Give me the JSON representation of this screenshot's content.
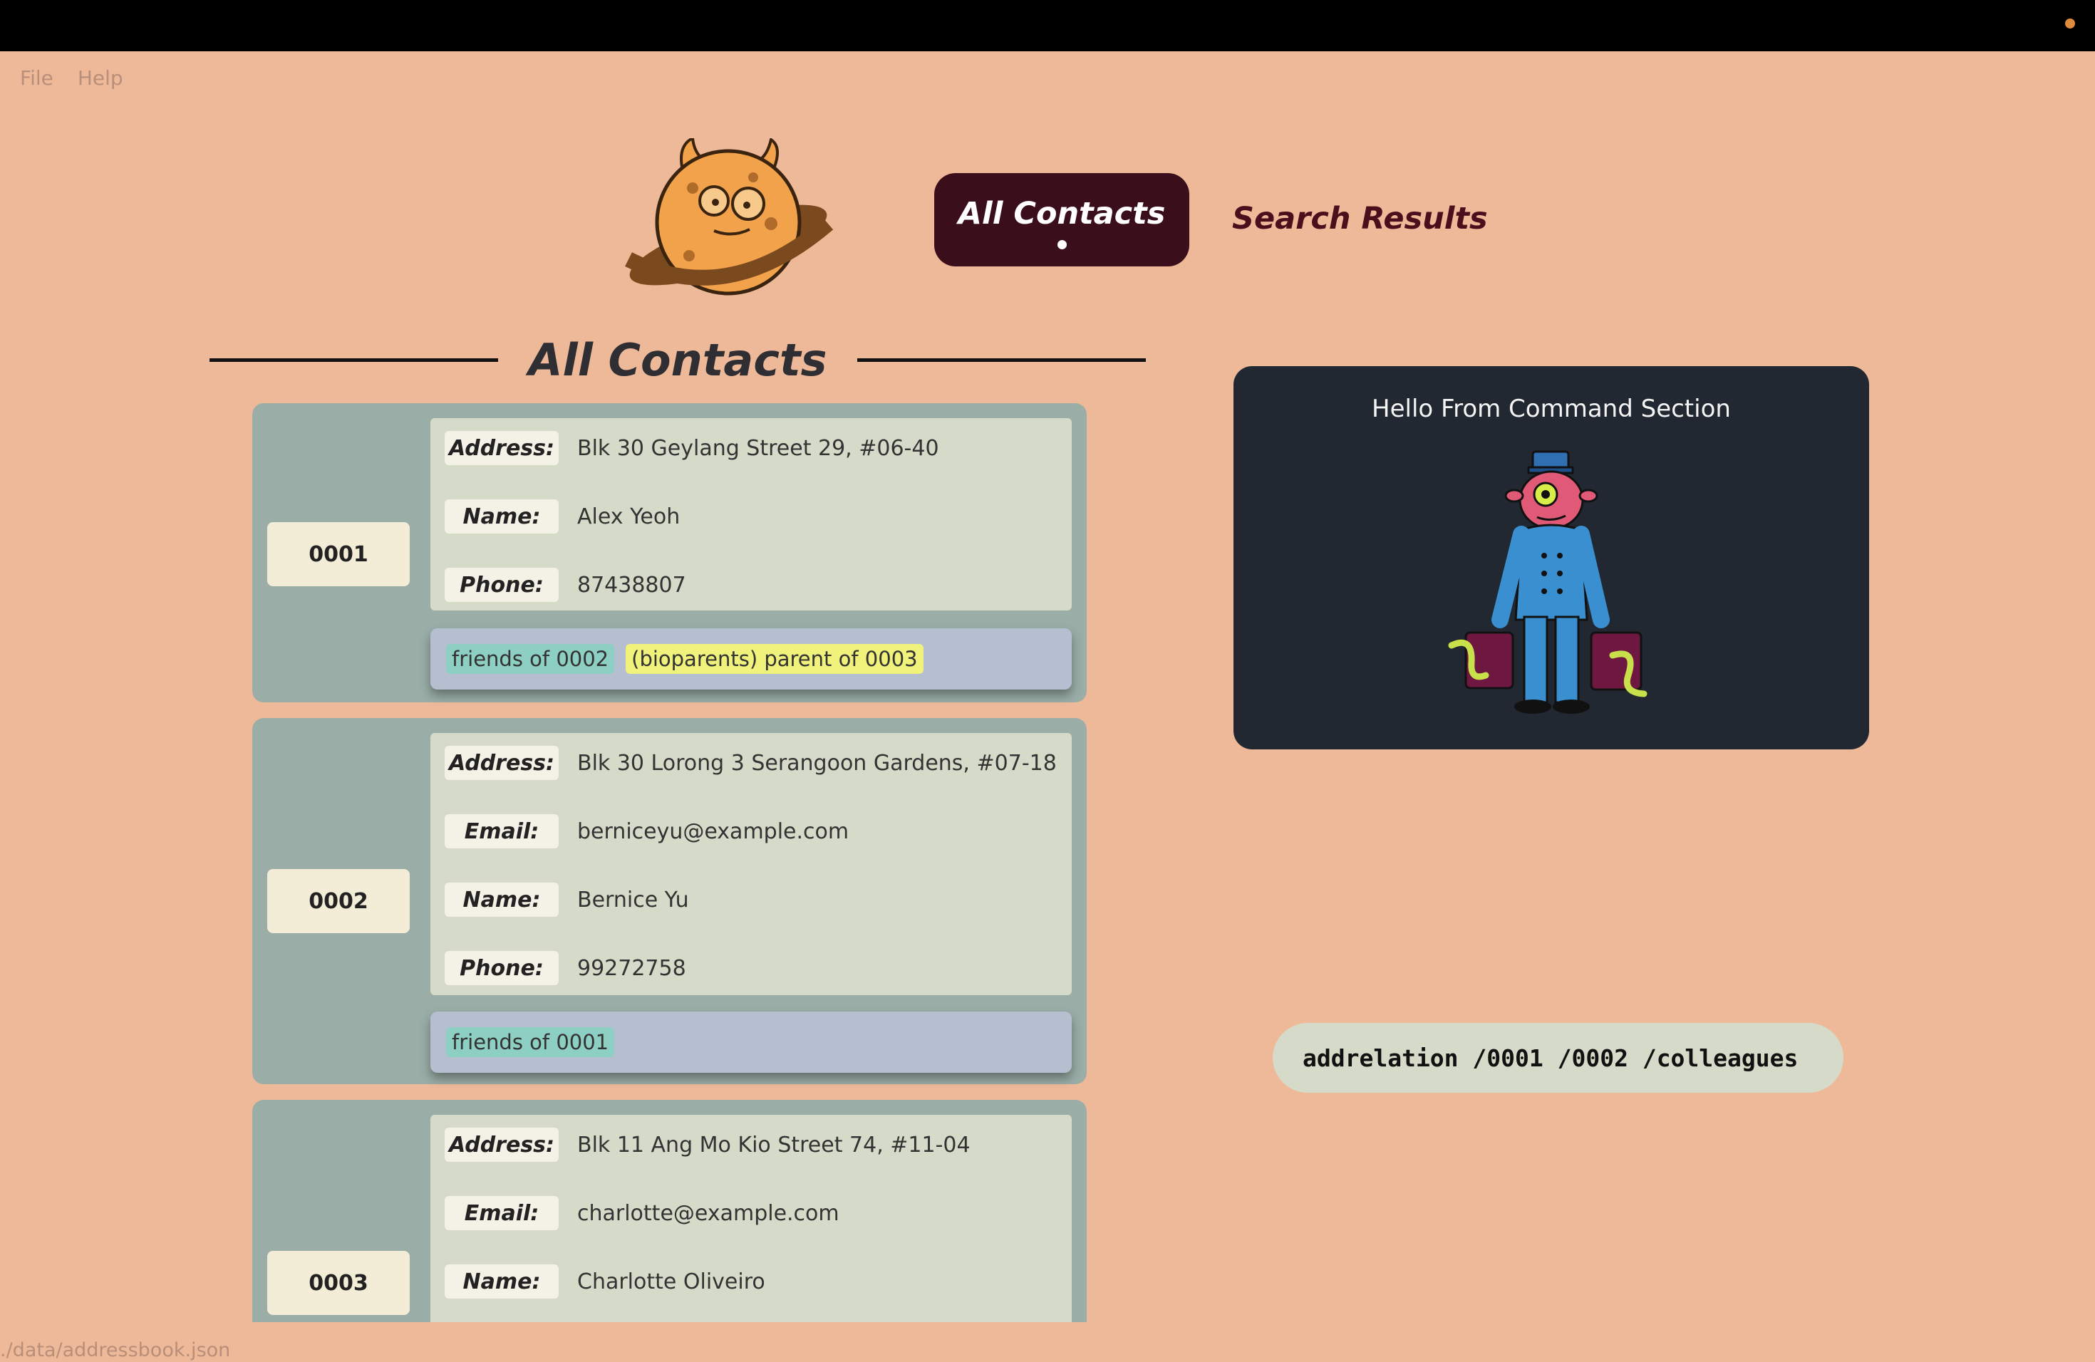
{
  "window": {},
  "menu": {
    "file": "File",
    "help": "Help"
  },
  "tabs": {
    "active": "All Contacts",
    "inactive": "Search Results"
  },
  "section": {
    "title": "All Contacts"
  },
  "contacts": [
    {
      "id": "0001",
      "fields": [
        {
          "label": "Address:",
          "value": "Blk 30 Geylang Street 29, #06-40"
        },
        {
          "label": "Name:",
          "value": "Alex Yeoh"
        },
        {
          "label": "Phone:",
          "value": "87438807"
        }
      ],
      "relations": [
        {
          "text": "friends of 0002",
          "color": "teal"
        },
        {
          "text": "(bioparents) parent of 0003",
          "color": "yellow"
        }
      ]
    },
    {
      "id": "0002",
      "fields": [
        {
          "label": "Address:",
          "value": "Blk 30 Lorong 3 Serangoon Gardens, #07-18"
        },
        {
          "label": "Email:",
          "value": "berniceyu@example.com"
        },
        {
          "label": "Name:",
          "value": "Bernice Yu"
        },
        {
          "label": "Phone:",
          "value": "99272758"
        }
      ],
      "relations": [
        {
          "text": "friends of 0001",
          "color": "teal"
        }
      ]
    },
    {
      "id": "0003",
      "fields": [
        {
          "label": "Address:",
          "value": "Blk 11 Ang Mo Kio Street 74, #11-04"
        },
        {
          "label": "Email:",
          "value": "charlotte@example.com"
        },
        {
          "label": "Name:",
          "value": "Charlotte Oliveiro"
        }
      ],
      "relations": []
    }
  ],
  "command": {
    "greeting": "Hello From Command Section",
    "input_value": "addrelation /0001 /0002 /colleagues"
  },
  "status": {
    "path": "./data/addressbook.json"
  },
  "colors": {
    "background": "#eeb999",
    "tab_active": "#3b0e1b",
    "card": "#9aada7",
    "fields_panel": "#d5dbc8",
    "tag_teal": "#8ecfc4",
    "tag_yellow": "#f0f27c",
    "command_panel": "#222831"
  }
}
